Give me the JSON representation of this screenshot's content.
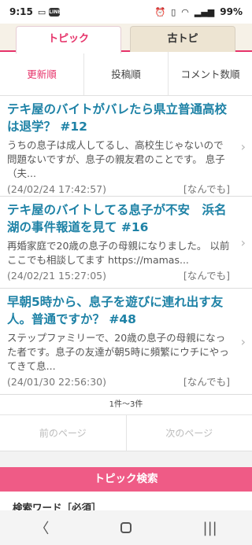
{
  "status_bar": {
    "time": "9:15",
    "battery": "99%",
    "left_icons": [
      "screen-mirror-icon",
      "line-app-icon"
    ],
    "right_icons": [
      "alarm-icon",
      "vibrate-icon",
      "wifi-icon",
      "signal-icon",
      "battery-icon"
    ]
  },
  "tabs": [
    {
      "label": "トピック",
      "active": true
    },
    {
      "label": "古トピ",
      "active": false
    }
  ],
  "sort": [
    {
      "label": "更新順",
      "active": true
    },
    {
      "label": "投稿順",
      "active": false
    },
    {
      "label": "コメント数順",
      "active": false
    }
  ],
  "topics": [
    {
      "title": "テキ屋のバイトがバレたら県立普通高校は退学？ #12",
      "snippet": "うちの息子は成人してるし、高校生じゃないので問題ないですが、息子の親友君のことです。 息子（夫...",
      "date": "(24/02/24 17:42:57)",
      "category": "[なんでも]"
    },
    {
      "title": "テキ屋のバイトしてる息子が不安　浜名湖の事件報道を見て #16",
      "snippet": "再婚家庭で20歳の息子の母親になりました。 以前ここでも相談してます https://mamas...",
      "date": "(24/02/21 15:27:05)",
      "category": "[なんでも]"
    },
    {
      "title": "早朝5時から、息子を遊びに連れ出す友人。普通ですか？ #48",
      "snippet": "ステップファミリーで、20歳の息子の母親になった者です。息子の友達が朝5時に頻繁にウチにやってきて息...",
      "date": "(24/01/30 22:56:30)",
      "category": "[なんでも]"
    }
  ],
  "result_count": "1件〜3件",
  "pager": {
    "prev": "前のページ",
    "next": "次のページ"
  },
  "search": {
    "header": "トピック検索",
    "keyword_label": "検索ワード［必須］"
  },
  "colors": {
    "accent": "#e6336a",
    "title_blue": "#1e82a6",
    "search_header": "#ef5b86"
  }
}
